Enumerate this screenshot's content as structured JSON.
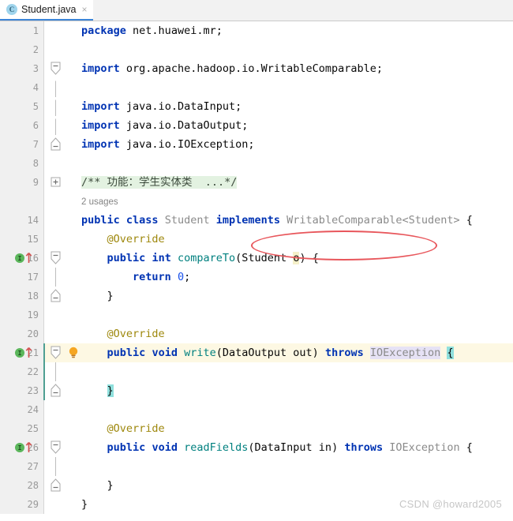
{
  "tab": {
    "icon": "java-class-icon",
    "label": "Student.java",
    "close": "×"
  },
  "editor": {
    "language": "java",
    "accent_color": "#3c85d8",
    "gutter_bg": "#f0f0f0",
    "caret_line_color": "#fdf8e3",
    "change_bar_color": "#4f9f93",
    "lines": [
      {
        "no": "1",
        "text": "package net.huawei.mr;"
      },
      {
        "no": "2",
        "text": ""
      },
      {
        "no": "3",
        "text": "import org.apache.hadoop.io.WritableComparable;"
      },
      {
        "no": "4",
        "text": ""
      },
      {
        "no": "5",
        "text": "import java.io.DataInput;"
      },
      {
        "no": "6",
        "text": "import java.io.DataOutput;"
      },
      {
        "no": "7",
        "text": "import java.io.IOException;"
      },
      {
        "no": "8",
        "text": ""
      },
      {
        "no": "9",
        "text": "/** 功能：学生实体类  ...*/"
      },
      {
        "no": "",
        "text": "2 usages"
      },
      {
        "no": "14",
        "text": "public class Student implements WritableComparable<Student> {"
      },
      {
        "no": "15",
        "text": "    @Override"
      },
      {
        "no": "16",
        "text": "    public int compareTo(Student o) {"
      },
      {
        "no": "17",
        "text": "        return 0;"
      },
      {
        "no": "18",
        "text": "    }"
      },
      {
        "no": "19",
        "text": ""
      },
      {
        "no": "20",
        "text": "    @Override"
      },
      {
        "no": "21",
        "text": "    public void write(DataOutput out) throws IOException {"
      },
      {
        "no": "22",
        "text": ""
      },
      {
        "no": "23",
        "text": "    }"
      },
      {
        "no": "24",
        "text": ""
      },
      {
        "no": "25",
        "text": "    @Override"
      },
      {
        "no": "26",
        "text": "    public void readFields(DataInput in) throws IOException {"
      },
      {
        "no": "27",
        "text": ""
      },
      {
        "no": "28",
        "text": "    }"
      },
      {
        "no": "29",
        "text": "}"
      }
    ],
    "inlay_hint": "2 usages",
    "folded_comment": "/** 功能：学生实体类  ...*/",
    "gutter_icons": {
      "implementing_method": "I",
      "override_arrow": "override-arrow-icon",
      "intention_bulb": "lightbulb-icon"
    }
  },
  "annotation": {
    "shape": "ellipse",
    "color": "#e8565b",
    "targets": "WritableComparable<Student>"
  },
  "watermark": "CSDN @howard2005"
}
